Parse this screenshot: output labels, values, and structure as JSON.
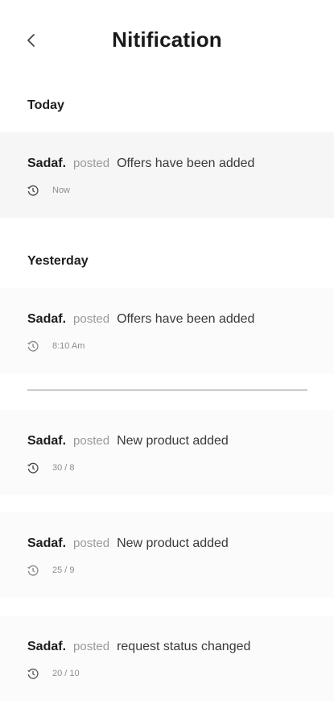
{
  "header": {
    "title": "Nitification",
    "back_icon": "chevron-left-icon"
  },
  "sections": [
    {
      "label": "Today",
      "items": [
        {
          "author": "Sadaf.",
          "verb": "posted",
          "message": "Offers have been added",
          "time": "Now"
        }
      ]
    },
    {
      "label": "Yesterday",
      "items": [
        {
          "author": "Sadaf.",
          "verb": "posted",
          "message": "Offers have been added",
          "time": "8:10 Am"
        },
        {
          "author": "Sadaf.",
          "verb": "posted",
          "message": "New product added",
          "time": "30 / 8"
        },
        {
          "author": "Sadaf.",
          "verb": "posted",
          "message": "New product added",
          "time": "25 / 9"
        },
        {
          "author": "Sadaf.",
          "verb": "posted",
          "message": "request status changed",
          "time": "20 / 10"
        }
      ]
    }
  ],
  "colors": {
    "card_shaded": "#f6f6f6",
    "card_light": "#fbfbfb",
    "divider": "#8a8a8a"
  }
}
